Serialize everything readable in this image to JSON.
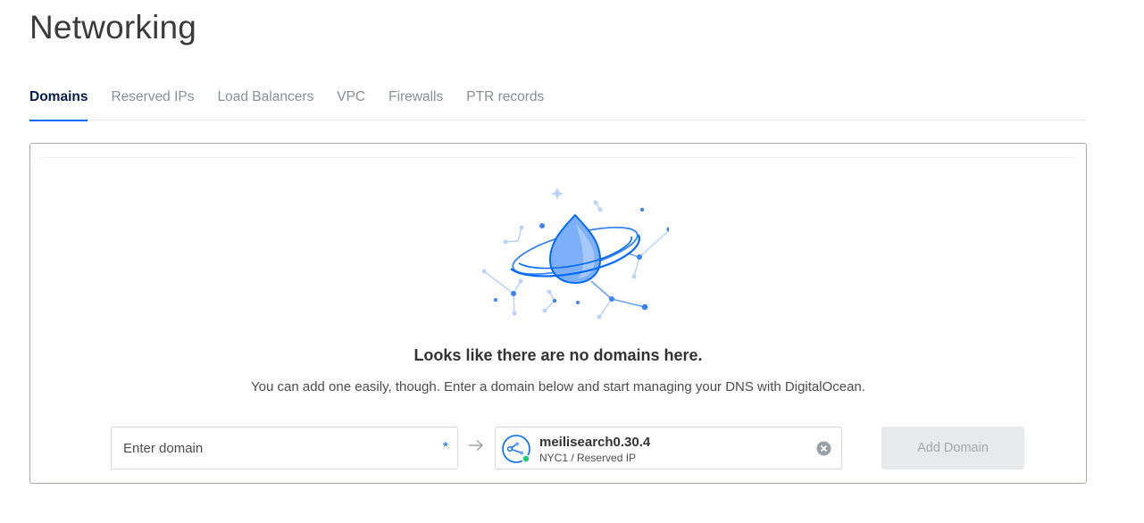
{
  "page": {
    "title": "Networking"
  },
  "tabs": [
    {
      "label": "Domains",
      "active": true
    },
    {
      "label": "Reserved IPs",
      "active": false
    },
    {
      "label": "Load Balancers",
      "active": false
    },
    {
      "label": "VPC",
      "active": false
    },
    {
      "label": "Firewalls",
      "active": false
    },
    {
      "label": "PTR records",
      "active": false
    }
  ],
  "empty_state": {
    "illustration": "droplet-planet-illustration",
    "title": "Looks like there are no domains here.",
    "text": "You can add one easily, though. Enter a domain below and start managing your DNS with DigitalOcean."
  },
  "form": {
    "domain_input": {
      "placeholder": "Enter domain",
      "value": "",
      "required_marker": "*"
    },
    "arrow_icon": "arrow-right-icon",
    "resource": {
      "icon": "reserved-ip-icon",
      "name": "meilisearch0.30.4",
      "subtitle": "NYC1 / Reserved IP",
      "status_color": "#15cd72"
    },
    "clear_icon": "clear-icon",
    "add_button_label": "Add Domain"
  },
  "colors": {
    "accent": "#0069ff",
    "active_tab_text": "#031b4e",
    "inactive_tab_text": "#8a8f97",
    "button_disabled_bg": "#e8e9eb",
    "button_disabled_text": "#a4a7ad"
  }
}
